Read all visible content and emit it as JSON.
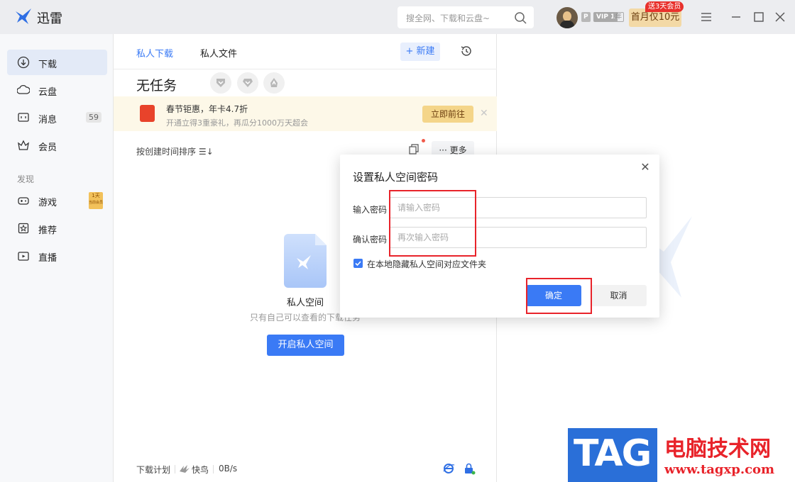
{
  "app": {
    "name": "迅雷"
  },
  "titlebar": {
    "search_placeholder": "搜全网、下载和云盘~",
    "vip_p": "P",
    "vip_level": "VIP 1",
    "vip_year": "年",
    "promo_tag": "送3天会员",
    "promo_button": "首月仅10元"
  },
  "sidebar": {
    "items": [
      {
        "label": "下载",
        "icon": "download-icon"
      },
      {
        "label": "云盘",
        "icon": "cloud-icon"
      },
      {
        "label": "消息",
        "icon": "message-icon",
        "count": "59"
      },
      {
        "label": "会员",
        "icon": "crown-icon"
      }
    ],
    "section": "发现",
    "discover": [
      {
        "label": "游戏",
        "icon": "gamepad-icon",
        "badge_top": "1天",
        "badge_bottom": "当前会员"
      },
      {
        "label": "推荐",
        "icon": "star-icon"
      },
      {
        "label": "直播",
        "icon": "live-icon"
      }
    ]
  },
  "main": {
    "tabs": [
      {
        "label": "私人下载"
      },
      {
        "label": "私人文件"
      }
    ],
    "new_button": "+ 新建",
    "no_task": "无任务",
    "banner": {
      "title": "春节钜惠，年卡4.7折",
      "subtitle": "开通立得3重豪礼，再瓜分1000万天超会",
      "button": "立即前往",
      "close": "✕"
    },
    "sort_label": "按创建时间排序 ☰↓",
    "more_button": "··· 更多",
    "private_title": "私人空间",
    "private_desc": "只有自己可以查看的下载任务",
    "open_button": "开启私人空间",
    "footer": {
      "plan": "下载计划",
      "mode": "快鸟",
      "speed": "0B/s"
    }
  },
  "dialog": {
    "title": "设置私人空间密码",
    "close": "✕",
    "password_label": "输入密码",
    "password_placeholder": "请输入密码",
    "confirm_label": "确认密码",
    "confirm_placeholder": "再次输入密码",
    "checkbox_label": "在本地隐藏私人空间对应文件夹",
    "ok_button": "确定",
    "cancel_button": "取消"
  },
  "watermark": {
    "logo": "TAG",
    "title": "电脑技术网",
    "url": "www.tagxp.com"
  },
  "colors": {
    "accent": "#3a7af5",
    "highlight_box": "#e8232a",
    "banner_bg": "#fdf8e8"
  }
}
